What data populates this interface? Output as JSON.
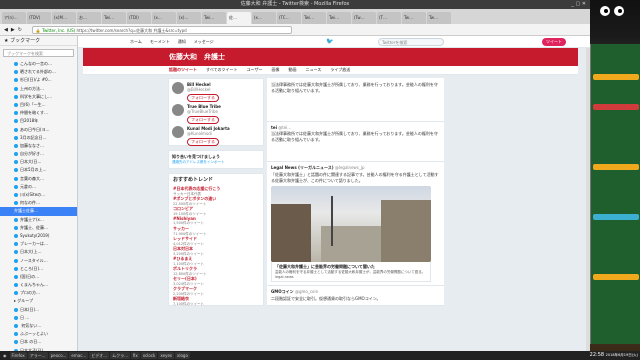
{
  "window": {
    "title": "佐藤大和 弁護士 - Twitter検索 - Mozilla Firefox"
  },
  "tabs": [
    "ア(n)…",
    "(TDV)",
    "(x)M…",
    "お…",
    "Twi…",
    "(TDI)",
    "(x…",
    "(x)…",
    "Twi…",
    "佐…",
    "(x…",
    "(TC…",
    "Twi…",
    "Twi…",
    "(Tw…",
    "(T…",
    "Tw…",
    "Tw…"
  ],
  "nav": {
    "url": "https://twitter.com/search?q=佐藤大和 弁護士&src=typd",
    "company": "Twitter, Inc. (US)"
  },
  "sidebar": {
    "title": "ブックマーク",
    "search_placeholder": "ブックマークを検索",
    "items": [
      "こんなの一言の…",
      "晒されてる外部の…",
      "杉日(日)/よ #0…",
      "上州の方法…",
      "科学を大事にし…",
      "目(6)「一生…",
      "仲間を暗くす…",
      "目2018年",
      "あの日今日(ヨ…",
      "3月の記念日…",
      "加藤ななさ…",
      "自分が好き…",
      "日本大(日…",
      "日本5月の上…",
      "言葉の森大…",
      "元倉の…",
      "川(x)Siteの…",
      "何なの件…",
      "弁護士ナ(x…",
      "弁護士、佐藤…",
      "Syukuty(2019) ",
      "ブレーカーは…",
      "日本大(上…",
      "ノースタイル…",
      "ところ(日)…",
      "(国)日の…",
      "くまんちゃん…",
      "プロの方…",
      "日本(日)…",
      "日 …",
      " 何気ない…",
      "ふぶーッとよい",
      "日本 の日…",
      "日本文子(日)…",
      "(a)(bacon…",
      "(x)(bacon…"
    ],
    "selected": "弁護士佐藤…",
    "group": "グループ"
  },
  "twitter": {
    "nav": [
      "ホーム",
      "モーメント",
      "通知",
      "メッセージ"
    ],
    "search_placeholder": "佐藤大和 弁護士",
    "tweet_btn": "ツイート",
    "lang": "Twitterを検索"
  },
  "banner": {
    "title": "佐藤大和　弁護士"
  },
  "subnav": [
    "話題のツイート",
    "すべてのツイート",
    "ユーザー",
    "画像",
    "動画",
    "ニュース",
    "ライブ放送"
  ],
  "who": [
    {
      "name": "Bill Heckel",
      "handle": "@BillHeckel"
    },
    {
      "name": "True Blue Tribe",
      "handle": "@TrueBlueTribe"
    },
    {
      "name": "Kunal Modi Jokarta",
      "handle": "@Kunalmodi"
    }
  ],
  "follow_label": "フォローする",
  "find_friends": "知り合いを見つけましょう",
  "find_friends_sub": "連絡先のアドレス帳をインポート",
  "trends_title": "おすすめトレンド",
  "trends": [
    {
      "name": "#日本代表の応援に行こう",
      "count": "サッカー日本代表"
    },
    {
      "name": "#ポンプとボタンの違い",
      "count": "22,500件のツイート"
    },
    {
      "name": "コロンビア",
      "count": "19,100件のツイート"
    },
    {
      "name": "#Nishiyan",
      "count": "1,500件のツイート"
    },
    {
      "name": "サッカー",
      "count": "71,900件のツイート"
    },
    {
      "name": "レッドサイド",
      "count": "4,012件のツイート"
    },
    {
      "name": "日本対日本",
      "count": "3,200件のツイート"
    },
    {
      "name": "#ひるまえ",
      "count": "1,100件のツイート"
    },
    {
      "name": "ポルトリクラ",
      "count": "12,800件のツイート"
    },
    {
      "name": "セリー(日本)",
      "count": "3,024件のツイート"
    },
    {
      "name": "クラブマーク",
      "count": "2,200件のツイート"
    },
    {
      "name": "新垣結衣",
      "count": "7,100件のツイート"
    }
  ],
  "tweets": [
    {
      "name": "tei",
      "handle": "@tei...",
      "text": "当法律事務所では佐藤大和弁護士が所属しており、業務を行っております。芸能人の権利を守る活動に取り組んでいます。"
    },
    {
      "name": "Legal News (リーガルニュース)",
      "handle": "@legalnews_jp",
      "text": "「佐藤大和弁護士」と話題の件に関連する記事です。芸能人の権利を守る弁護士として活動する佐藤大和弁護士が、この件について語りました。"
    },
    {
      "name": "GMOコイン",
      "handle": "@gmo_coin",
      "text": "二段階認証で安全に取引。仮想通貨の取引ならGMOコイン。"
    }
  ],
  "link": {
    "title": "「佐藤大和弁護士」に芸能界の労働問題について聞いた",
    "desc": "芸能人の権利を守る弁護士として活動する佐藤大和弁護士が、芸能界の労働問題について語る。legal.news"
  },
  "taskbar": {
    "items": [
      "Firefox",
      "アラー...",
      "peoco...",
      "emac...",
      "ビデオ...",
      "ムクラ...",
      "fix",
      "xclock",
      "xeyes",
      "xlogo"
    ],
    "clock": "22:58",
    "date": "2018年6月19日(火)"
  },
  "colors": {
    "brand": "#c51b2d",
    "twitter_blue": "#1da1f2",
    "selection": "#3b82f6"
  }
}
